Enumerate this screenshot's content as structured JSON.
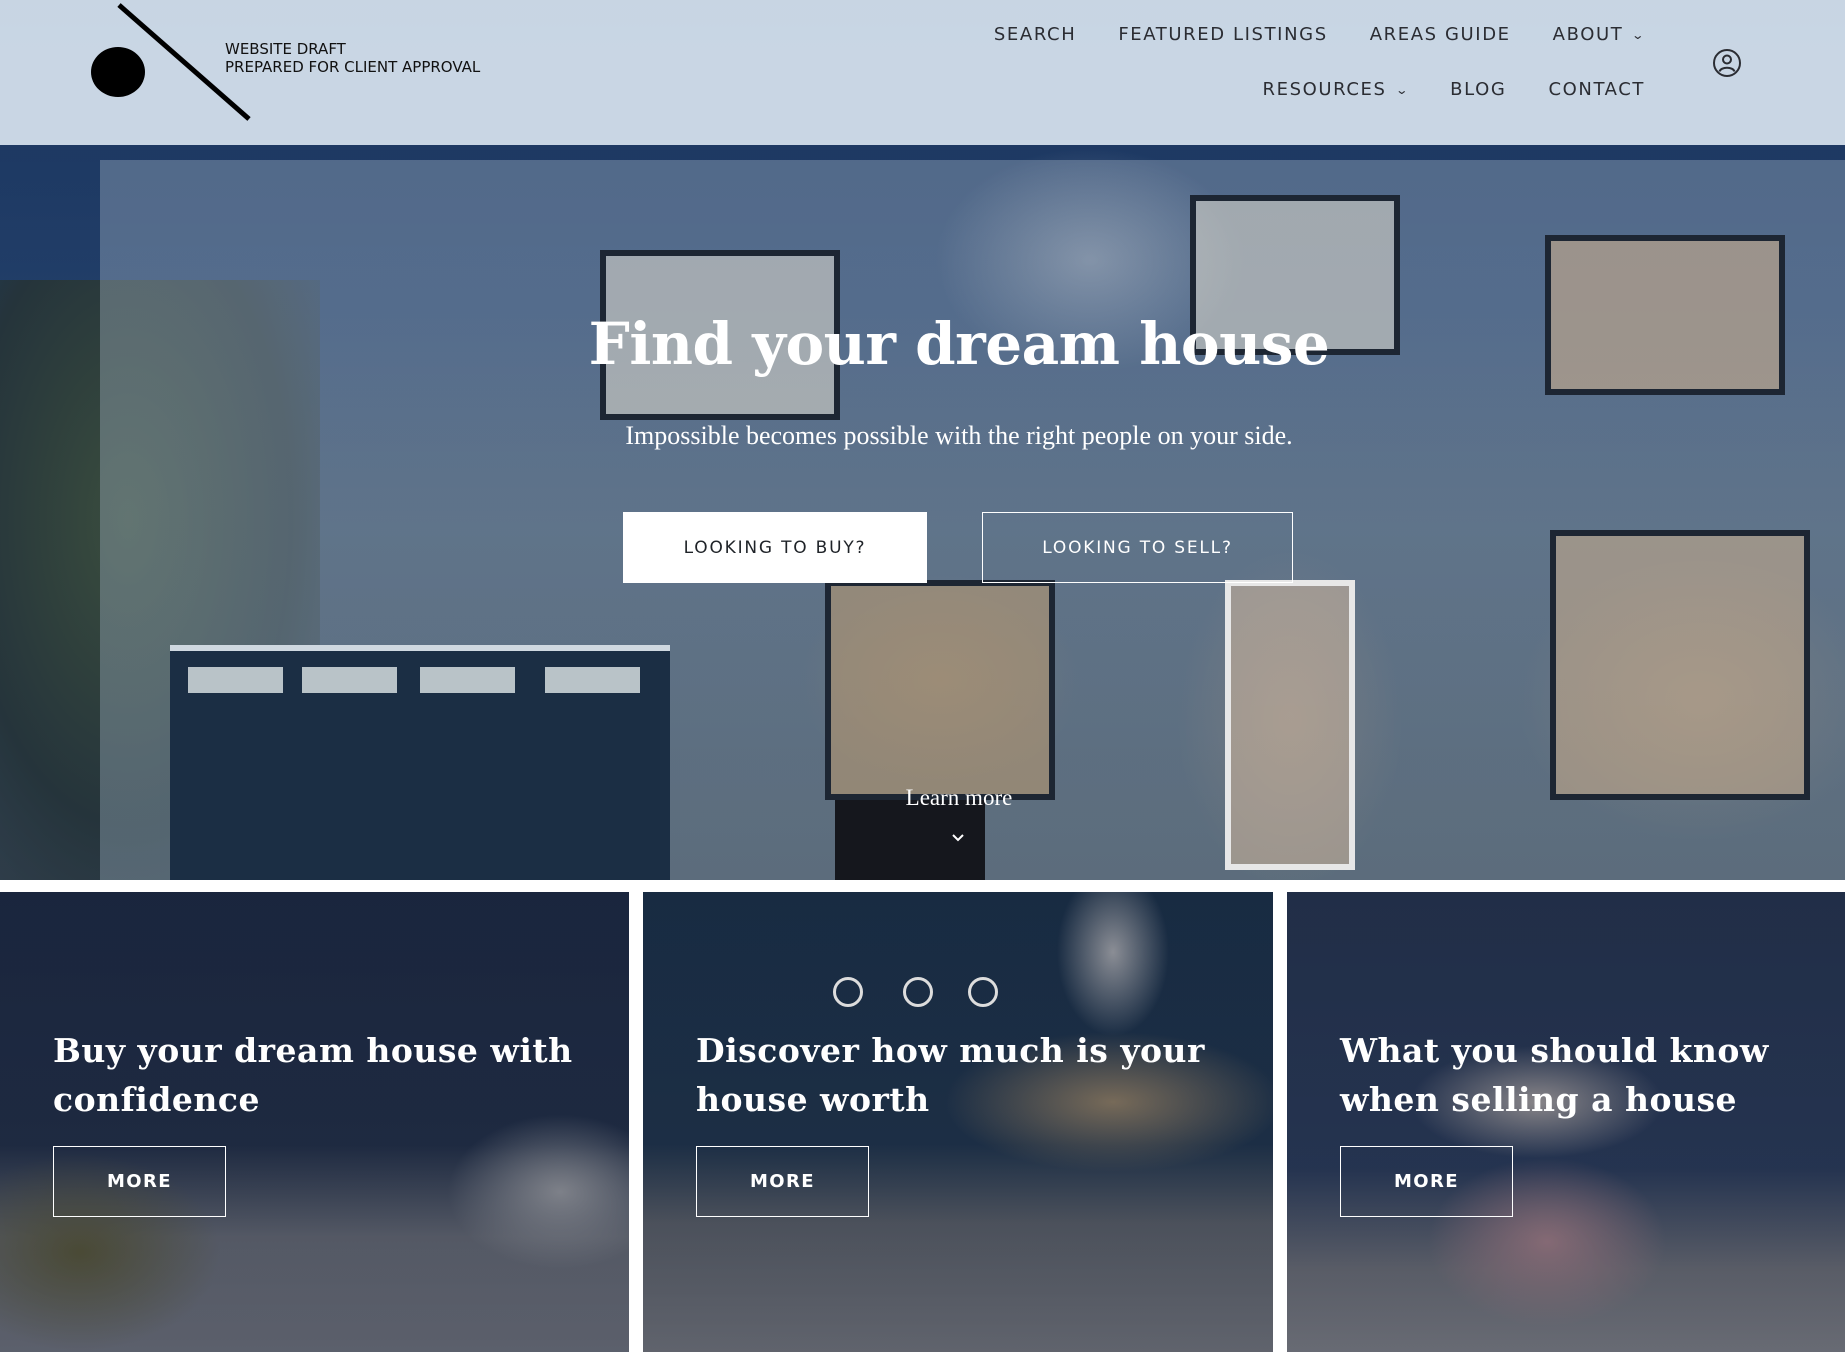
{
  "header": {
    "logo_line1": "WEBSITE DRAFT",
    "logo_line2": "PREPARED FOR CLIENT APPROVAL",
    "nav_row1": [
      {
        "label": "SEARCH",
        "has_dropdown": false
      },
      {
        "label": "FEATURED LISTINGS",
        "has_dropdown": false
      },
      {
        "label": "AREAS GUIDE",
        "has_dropdown": false
      },
      {
        "label": "ABOUT",
        "has_dropdown": true
      }
    ],
    "nav_row2": [
      {
        "label": "RESOURCES",
        "has_dropdown": true
      },
      {
        "label": "BLOG",
        "has_dropdown": false
      },
      {
        "label": "CONTACT",
        "has_dropdown": false
      }
    ],
    "account_icon": "user-circle-icon",
    "chevron_glyph": "⌄"
  },
  "hero": {
    "title": "Find your dream house",
    "subtitle": "Impossible becomes possible with the right people on your side.",
    "buy_label": "LOOKING TO BUY?",
    "sell_label": "LOOKING TO SELL?",
    "learn_more": "Learn more"
  },
  "cards": [
    {
      "title": "Buy your dream house with confidence",
      "button": "MORE"
    },
    {
      "title": "Discover how much is your house worth",
      "button": "MORE"
    },
    {
      "title": "What you should know when selling a house",
      "button": "MORE"
    }
  ],
  "colors": {
    "header_bg": "#d6e2ee",
    "nav_text": "#2b2d33",
    "primary_button_bg": "#ffffff",
    "primary_button_text": "#1f2328",
    "overlay_text": "#ffffff"
  }
}
